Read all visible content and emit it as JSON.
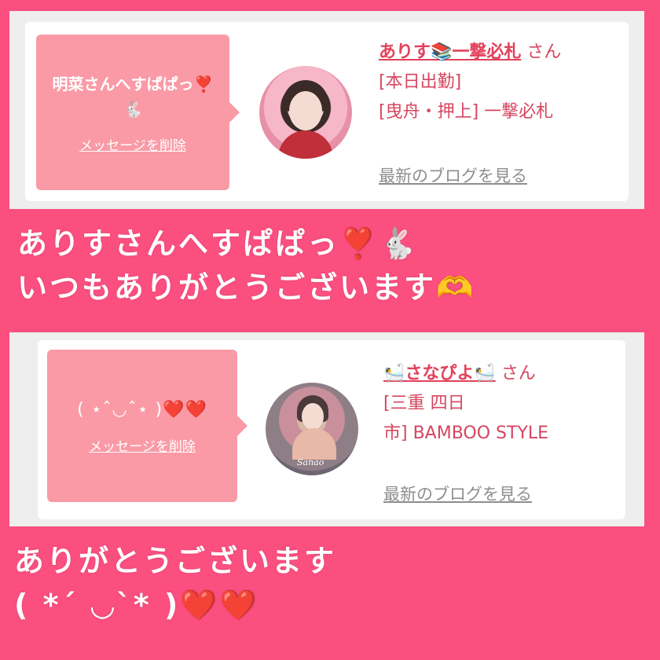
{
  "colors": {
    "background": "#fa4f7f",
    "bubble": "#fa9aa6",
    "name_link": "#e2425b",
    "blog_link": "#8e8e8e"
  },
  "messages": [
    {
      "bubble_text": "明菜さんへすぱぱっ❣️🐇",
      "delete_label": "メッセージを削除",
      "name": "ありす📚一撃必札",
      "name_suffix": "さん",
      "detail_line1": "[本日出勤]",
      "detail_line2": "[曳舟・押上] 一撃必札",
      "blog_label": "最新のブログを見る"
    },
    {
      "bubble_text": "( ⋆ˆ◡ˆ⋆ )❤️❤️",
      "delete_label": "メッセージを削除",
      "name": "🛀さなぴよ🛀",
      "name_suffix": "さん",
      "detail_line1": "[三重 四日",
      "detail_line2": "市] BAMBOO STYLE",
      "blog_label": "最新のブログを見る",
      "avatar_signature": "Sanao"
    }
  ],
  "overlay_texts": {
    "line1": "ありすさんへすぱぱっ❣️🐇",
    "line2": "いつもありがとうございます🫶",
    "line3": "ありがとうございます",
    "line4": "( *´ ◡`* )❤️❤️"
  }
}
